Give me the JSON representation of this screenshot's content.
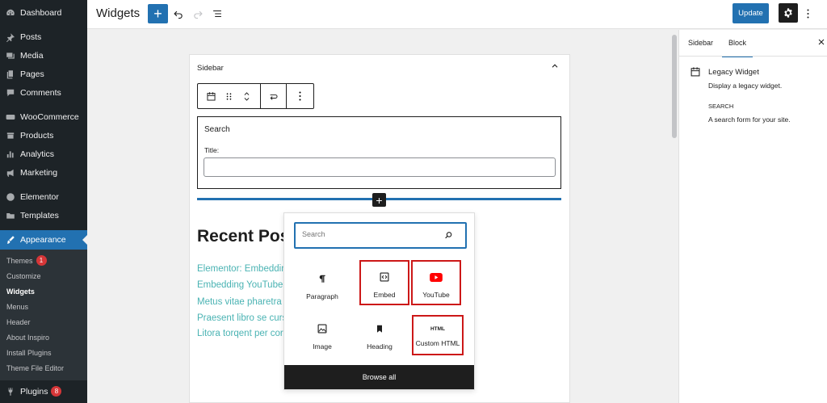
{
  "admin_menu": {
    "items": [
      {
        "label": "Dashboard",
        "icon": "dashboard-icon"
      },
      {
        "label": "Posts",
        "icon": "pin-icon"
      },
      {
        "label": "Media",
        "icon": "media-icon"
      },
      {
        "label": "Pages",
        "icon": "pages-icon"
      },
      {
        "label": "Comments",
        "icon": "comments-icon"
      },
      {
        "label": "WooCommerce",
        "icon": "woocommerce-icon"
      },
      {
        "label": "Products",
        "icon": "products-icon"
      },
      {
        "label": "Analytics",
        "icon": "analytics-icon"
      },
      {
        "label": "Marketing",
        "icon": "megaphone-icon"
      },
      {
        "label": "Elementor",
        "icon": "elementor-icon"
      },
      {
        "label": "Templates",
        "icon": "folder-icon"
      },
      {
        "label": "Appearance",
        "icon": "brush-icon"
      }
    ],
    "submenu": [
      {
        "label": "Themes",
        "badge": "1"
      },
      {
        "label": "Customize"
      },
      {
        "label": "Widgets"
      },
      {
        "label": "Menus"
      },
      {
        "label": "Header"
      },
      {
        "label": "About Inspiro"
      },
      {
        "label": "Install Plugins"
      },
      {
        "label": "Theme File Editor"
      }
    ],
    "plugins": {
      "label": "Plugins",
      "badge": "8"
    }
  },
  "toolbar": {
    "title": "Widgets",
    "add_label": "+",
    "update_label": "Update"
  },
  "widget_area": {
    "title": "Sidebar",
    "search_widget": {
      "title": "Search",
      "field_label": "Title:",
      "field_value": ""
    },
    "recent_posts_title": "Recent Pos",
    "recent_links": [
      "Elementor: Embeddin",
      "Embedding YouTube",
      "Metus vitae pharetra",
      "Praesent libro se curs",
      "Litora torqent per cor"
    ]
  },
  "inserter": {
    "search_placeholder": "Search",
    "blocks": [
      {
        "label": "Paragraph",
        "icon": "paragraph-icon",
        "highlighted": false
      },
      {
        "label": "Embed",
        "icon": "embed-icon",
        "highlighted": true
      },
      {
        "label": "YouTube",
        "icon": "youtube-icon",
        "highlighted": true
      },
      {
        "label": "Image",
        "icon": "image-icon",
        "highlighted": false
      },
      {
        "label": "Heading",
        "icon": "bookmark-icon",
        "highlighted": false
      },
      {
        "label": "Custom HTML",
        "icon_text": "HTML",
        "highlighted": true
      }
    ],
    "browse_all": "Browse all"
  },
  "settings_panel": {
    "tabs": [
      "Sidebar",
      "Block"
    ],
    "active_tab": "Block",
    "block_name": "Legacy Widget",
    "block_description": "Display a legacy widget.",
    "section_title": "SEARCH",
    "section_description": "A search form for your site."
  },
  "colors": {
    "admin_bg": "#1d2327",
    "accent": "#2271b1",
    "highlight": "#cc1818",
    "link": "#4ab3b3",
    "youtube": "#ff0000"
  }
}
